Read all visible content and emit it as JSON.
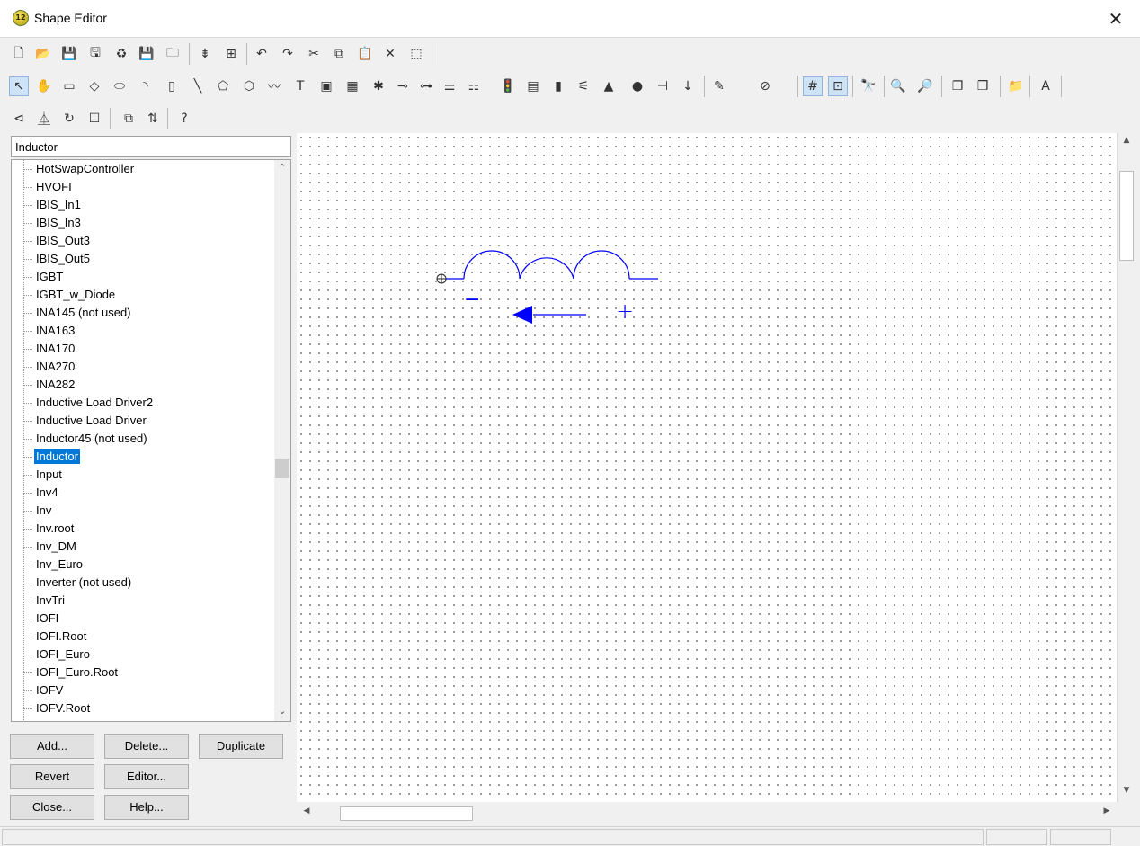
{
  "window": {
    "title": "Shape Editor",
    "app_icon_text": "12",
    "close_glyph": "✕"
  },
  "toolbars": {
    "row1": [
      "new-icon",
      "open-icon",
      "save-icon",
      "save-as-icon",
      "refresh-icon",
      "save-all-icon",
      "export-icon",
      "insert-pin-icon",
      "insert-group-icon",
      "undo-icon",
      "redo-icon",
      "cut-icon",
      "copy-icon",
      "paste-icon",
      "delete-icon",
      "select-region-icon"
    ],
    "row2": [
      "pointer-icon",
      "pan-hand-icon",
      "rectangle-icon",
      "diamond-icon",
      "ellipse-icon",
      "arc-icon",
      "bracket-icon",
      "line-icon",
      "polygon-icon",
      "hexagon-icon",
      "wave-icon",
      "text-icon",
      "image-icon",
      "chip-icon",
      "bug-icon",
      "connector-icon",
      "switch-icon",
      "jumper-icon",
      "dip-icon",
      "traffic-light-icon",
      "display-icon",
      "battery-icon",
      "relay-icon",
      "led-icon",
      "record-icon",
      "plug-icon",
      "down-arrow-icon",
      "pen-color-icon",
      "fill-color-icon",
      "grid-icon",
      "snap-icon",
      "binoculars-icon",
      "zoom-out-icon",
      "zoom-in-icon",
      "bring-front-icon",
      "send-back-icon",
      "folder-icon",
      "font-icon"
    ],
    "row3": [
      "align-left-icon",
      "flip-icon",
      "rotate-icon",
      "checkbox-icon",
      "properties-icon",
      "sort-az-icon",
      "help-icon"
    ],
    "glyphs": {
      "row1": [
        "🗋",
        "📂",
        "💾",
        "🖫",
        "♻",
        "💾",
        "🗀",
        "⇟",
        "⊞",
        "↶",
        "↷",
        "✂",
        "⧉",
        "📋",
        "✕",
        "⬚"
      ],
      "row2": [
        "↖",
        "✋",
        "▭",
        "◇",
        "⬭",
        "◝",
        "▯",
        "╲",
        "⬠",
        "⬡",
        "〰",
        "T",
        "▣",
        "▦",
        "✱",
        "⊸",
        "⊶",
        "⚌",
        "⚏",
        "🚦",
        "▤",
        "▮",
        "⚟",
        "▲",
        "●",
        "⊣",
        "↓",
        "✎",
        "⊘",
        "#",
        "⊡",
        "🔭",
        "🔍",
        "🔎",
        "❐",
        "❒",
        "📁",
        "A"
      ],
      "row3": [
        "⊲",
        "⏅",
        "↻",
        "☐",
        "⧉",
        "⇅",
        "?"
      ]
    }
  },
  "search": {
    "value": "Inductor"
  },
  "tree": {
    "items": [
      "HotSwapController",
      "HVOFI",
      "IBIS_In1",
      "IBIS_In3",
      "IBIS_Out3",
      "IBIS_Out5",
      "IGBT",
      "IGBT_w_Diode",
      "INA145 (not used)",
      "INA163",
      "INA170",
      "INA270",
      "INA282",
      "Inductive Load Driver2",
      "Inductive Load Driver",
      "Inductor45 (not used)",
      "Inductor",
      "Input",
      "Inv4",
      "Inv",
      "Inv.root",
      "Inv_DM",
      "Inv_Euro",
      "Inverter (not used)",
      "InvTri",
      "IOFI",
      "IOFI.Root",
      "IOFI_Euro",
      "IOFI_Euro.Root",
      "IOFV",
      "IOFV.Root"
    ],
    "selected_index": 16,
    "scroll_up": "⌃",
    "scroll_down": "⌄"
  },
  "buttons": {
    "add": "Add...",
    "delete": "Delete...",
    "duplicate": "Duplicate",
    "revert": "Revert",
    "editor": "Editor...",
    "close": "Close...",
    "help": "Help..."
  },
  "canvas": {
    "minus_label": "−",
    "plus_label": "+",
    "shape_color": "#0000ff"
  },
  "scroll_arrows": {
    "up": "▲",
    "down": "▼",
    "left": "◀",
    "right": "▶"
  }
}
